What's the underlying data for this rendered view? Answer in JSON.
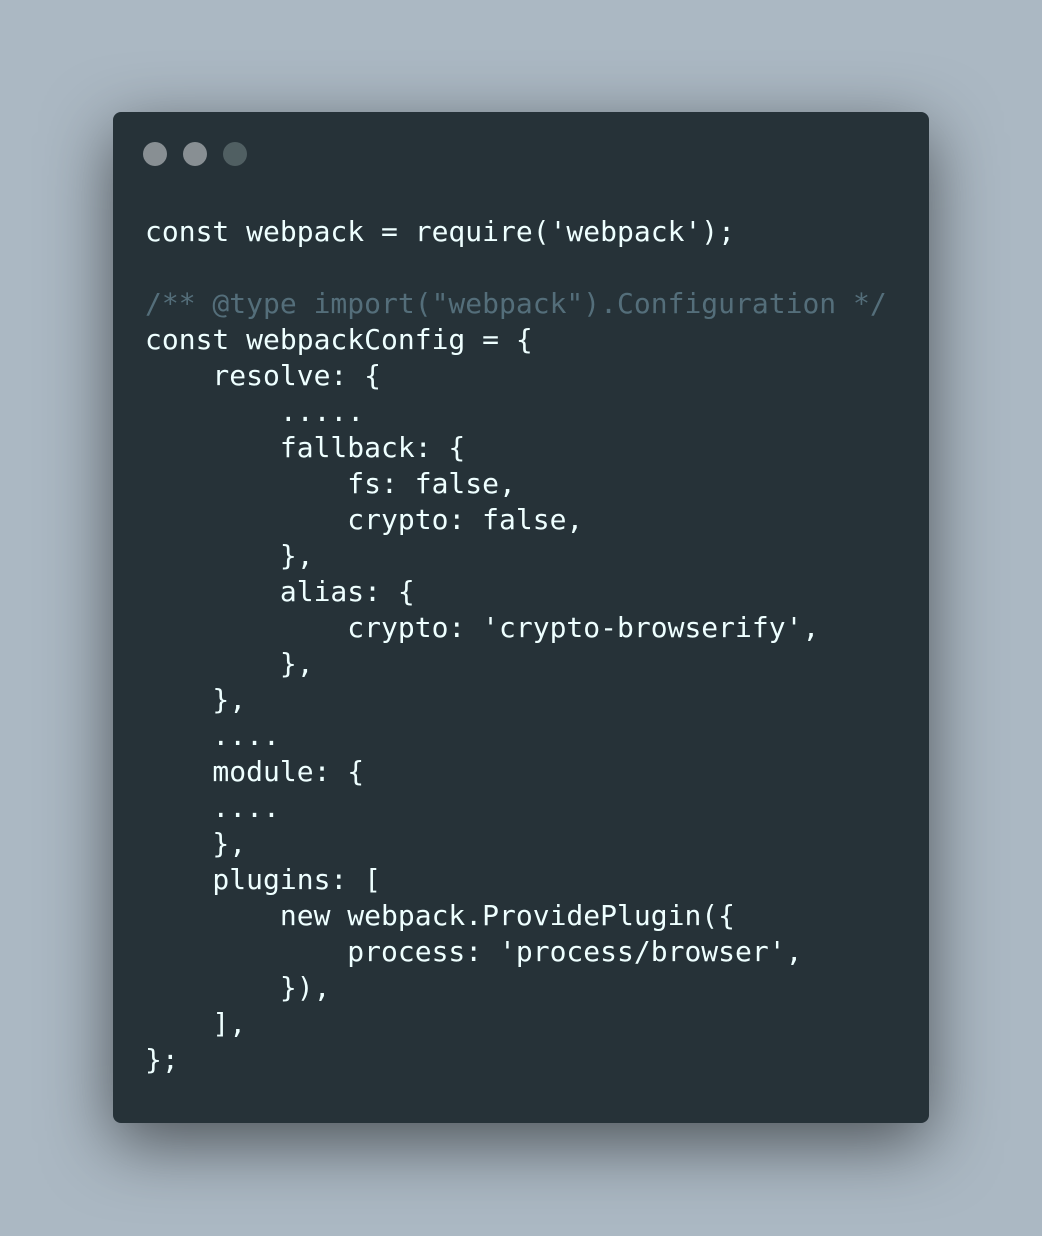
{
  "window": {
    "background_color": "#263238",
    "page_background_color": "#abb8c3",
    "controls": [
      {
        "name": "close-dot",
        "color": "#888f93"
      },
      {
        "name": "minimize-dot",
        "color": "#888f93"
      },
      {
        "name": "maximize-dot",
        "color": "#505f62"
      }
    ]
  },
  "code": {
    "text_color": "#eeffff",
    "comment_color": "#546e7a",
    "lines": [
      {
        "text": "const webpack = require('webpack');",
        "comment": false
      },
      {
        "text": "",
        "comment": false
      },
      {
        "text": "/** @type import(\"webpack\").Configuration */",
        "comment": true
      },
      {
        "text": "const webpackConfig = {",
        "comment": false
      },
      {
        "text": "    resolve: {",
        "comment": false
      },
      {
        "text": "        .....",
        "comment": false
      },
      {
        "text": "        fallback: {",
        "comment": false
      },
      {
        "text": "            fs: false,",
        "comment": false
      },
      {
        "text": "            crypto: false,",
        "comment": false
      },
      {
        "text": "        },",
        "comment": false
      },
      {
        "text": "        alias: {",
        "comment": false
      },
      {
        "text": "            crypto: 'crypto-browserify',",
        "comment": false
      },
      {
        "text": "        },",
        "comment": false
      },
      {
        "text": "    },",
        "comment": false
      },
      {
        "text": "    ....",
        "comment": false
      },
      {
        "text": "    module: {",
        "comment": false
      },
      {
        "text": "    ....",
        "comment": false
      },
      {
        "text": "    },",
        "comment": false
      },
      {
        "text": "    plugins: [",
        "comment": false
      },
      {
        "text": "        new webpack.ProvidePlugin({",
        "comment": false
      },
      {
        "text": "            process: 'process/browser',",
        "comment": false
      },
      {
        "text": "        }),",
        "comment": false
      },
      {
        "text": "    ],",
        "comment": false
      },
      {
        "text": "};",
        "comment": false
      }
    ]
  }
}
